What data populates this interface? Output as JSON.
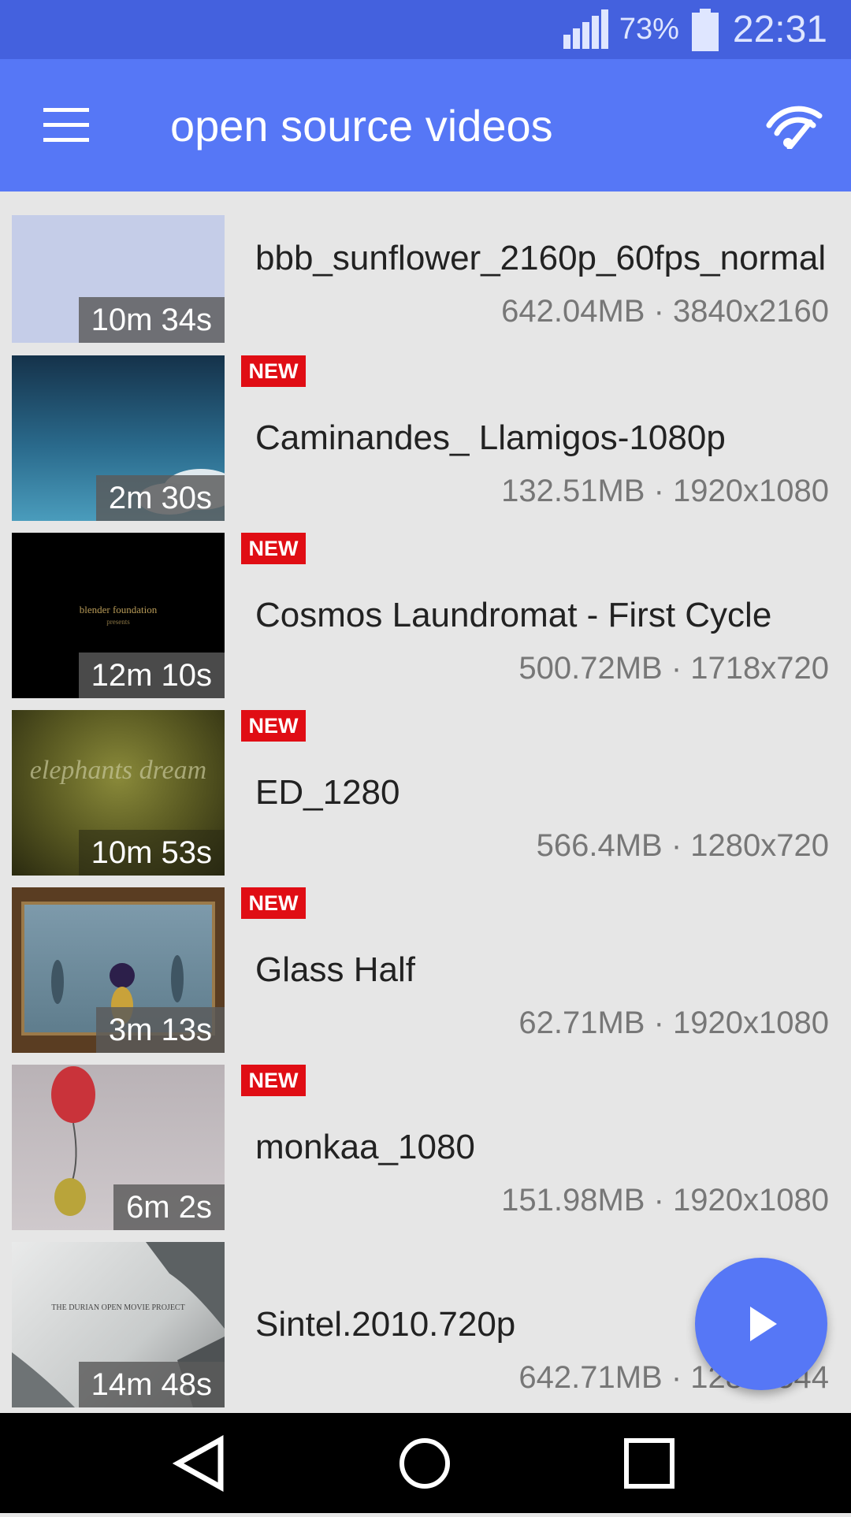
{
  "status_bar": {
    "battery": "73%",
    "time": "22:31",
    "signal_icon": "signal-icon",
    "battery_icon": "battery-icon"
  },
  "app_bar": {
    "title": "open source videos",
    "menu_icon": "menu-icon",
    "cast_icon": "cast-icon"
  },
  "videos": [
    {
      "title": "bbb_sunflower_2160p_60fps_normal",
      "duration": "10m 34s",
      "meta": "642.04MB · 3840x2160",
      "is_new": false,
      "badge": ""
    },
    {
      "title": "Caminandes_ Llamigos-1080p",
      "duration": "2m 30s",
      "meta": "132.51MB · 1920x1080",
      "is_new": true,
      "badge": "NEW"
    },
    {
      "title": "Cosmos Laundromat - First Cycle",
      "duration": "12m 10s",
      "meta": "500.72MB · 1718x720",
      "is_new": true,
      "badge": "NEW"
    },
    {
      "title": "ED_1280",
      "duration": "10m 53s",
      "meta": "566.4MB · 1280x720",
      "is_new": true,
      "badge": "NEW"
    },
    {
      "title": "Glass Half",
      "duration": "3m 13s",
      "meta": "62.71MB · 1920x1080",
      "is_new": true,
      "badge": "NEW"
    },
    {
      "title": "monkaa_1080",
      "duration": "6m 2s",
      "meta": "151.98MB · 1920x1080",
      "is_new": true,
      "badge": "NEW"
    },
    {
      "title": "Sintel.2010.720p",
      "duration": "14m 48s",
      "meta": "642.71MB · 1280x544",
      "is_new": false,
      "badge": ""
    }
  ],
  "thumbnail_text": {
    "cosmos": "blender foundation",
    "cosmos_sub": "presents",
    "elephants": "elephants dream",
    "sintel": "THE DURIAN OPEN MOVIE PROJECT"
  },
  "fab": {
    "icon": "play-icon"
  },
  "nav_bar": {
    "back_icon": "back-icon",
    "home_icon": "home-icon",
    "recents_icon": "recents-icon"
  },
  "colors": {
    "status_bar": "#4461de",
    "app_bar": "#5677f6",
    "badge": "#e00d14",
    "background": "#e6e6e6"
  }
}
